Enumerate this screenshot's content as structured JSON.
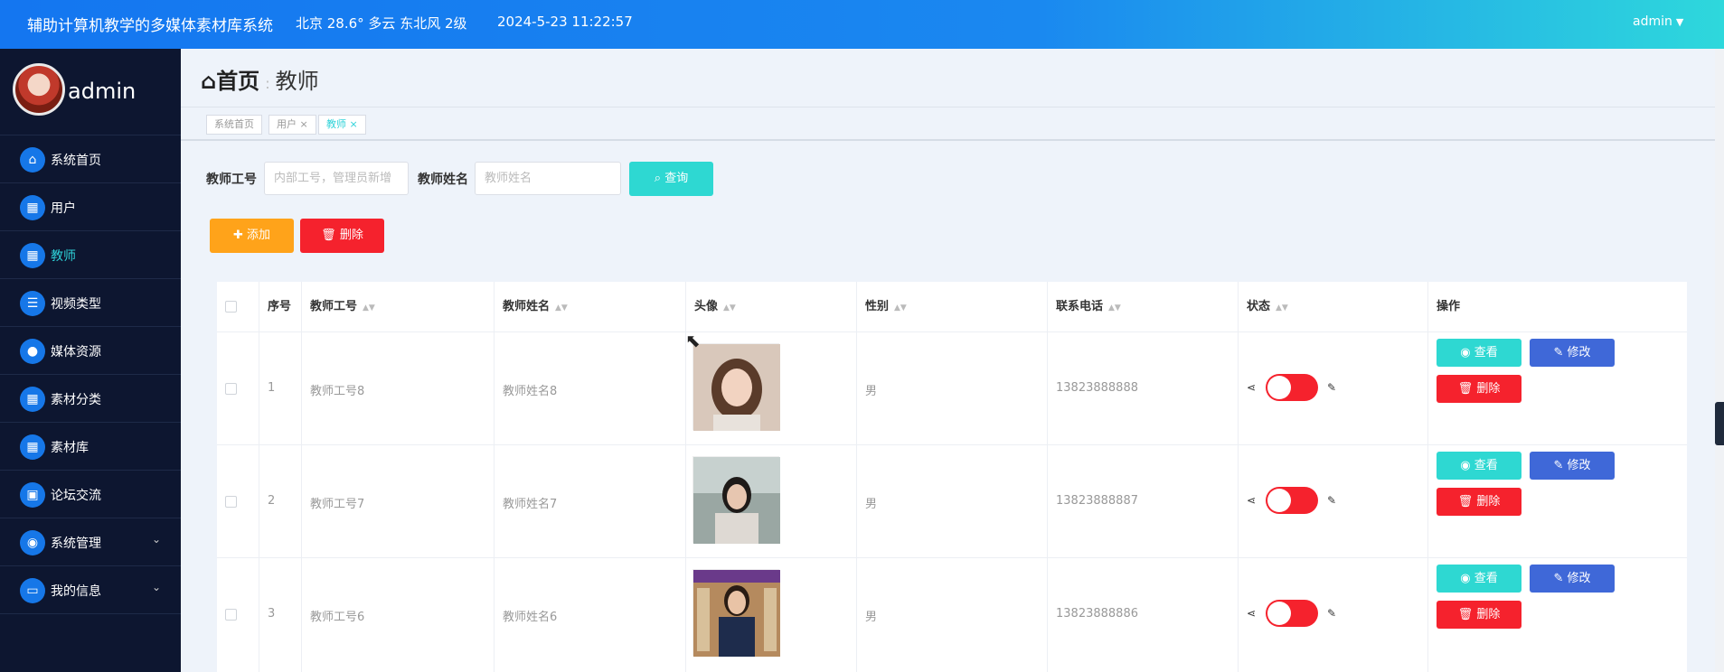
{
  "header": {
    "title": "辅助计算机教学的多媒体素材库系统",
    "weather": "北京  28.6°  多云  东北风  2级",
    "datetime": "2024-5-23 11:22:57",
    "user": "admin"
  },
  "sidebar": {
    "profile_name": "admin",
    "items": [
      {
        "label": "系统首页",
        "icon": "home-icon"
      },
      {
        "label": "用户",
        "icon": "grid-icon"
      },
      {
        "label": "教师",
        "icon": "grid-icon"
      },
      {
        "label": "视频类型",
        "icon": "list-icon"
      },
      {
        "label": "媒体资源",
        "icon": "user-icon"
      },
      {
        "label": "素材分类",
        "icon": "grid-icon"
      },
      {
        "label": "素材库",
        "icon": "grid-icon"
      },
      {
        "label": "论坛交流",
        "icon": "briefcase-icon"
      },
      {
        "label": "系统管理",
        "icon": "bulb-icon"
      },
      {
        "label": "我的信息",
        "icon": "card-icon"
      }
    ]
  },
  "breadcrumb": {
    "home": "首页",
    "current": "教师"
  },
  "tags": [
    {
      "label": "系统首页"
    },
    {
      "label": "用户 ×"
    },
    {
      "label": "教师 ×"
    }
  ],
  "search": {
    "teacher_id_label": "教师工号",
    "teacher_id_placeholder": "内部工号，管理员新增",
    "teacher_name_label": "教师姓名",
    "teacher_name_placeholder": "教师姓名",
    "query_label": "查询"
  },
  "actions": {
    "add_label": "添加",
    "delete_label": "删除"
  },
  "table": {
    "columns": [
      "序号",
      "教师工号",
      "教师姓名",
      "头像",
      "性别",
      "联系电话",
      "状态",
      "操作"
    ],
    "rows": [
      {
        "index": "1",
        "teacher_id": "教师工号8",
        "teacher_name": "教师姓名8",
        "gender": "男",
        "phone": "13823888888"
      },
      {
        "index": "2",
        "teacher_id": "教师工号7",
        "teacher_name": "教师姓名7",
        "gender": "男",
        "phone": "13823888887"
      },
      {
        "index": "3",
        "teacher_id": "教师工号6",
        "teacher_name": "教师姓名6",
        "gender": "男",
        "phone": "13823888886"
      }
    ],
    "row_buttons": {
      "view": "查看",
      "edit": "修改",
      "delete": "删除"
    }
  },
  "colors": {
    "accent": "#2ed8d2",
    "primary": "#1677e8",
    "danger": "#f5222d",
    "warning": "#ffa31a",
    "edit": "#3f68d8"
  }
}
